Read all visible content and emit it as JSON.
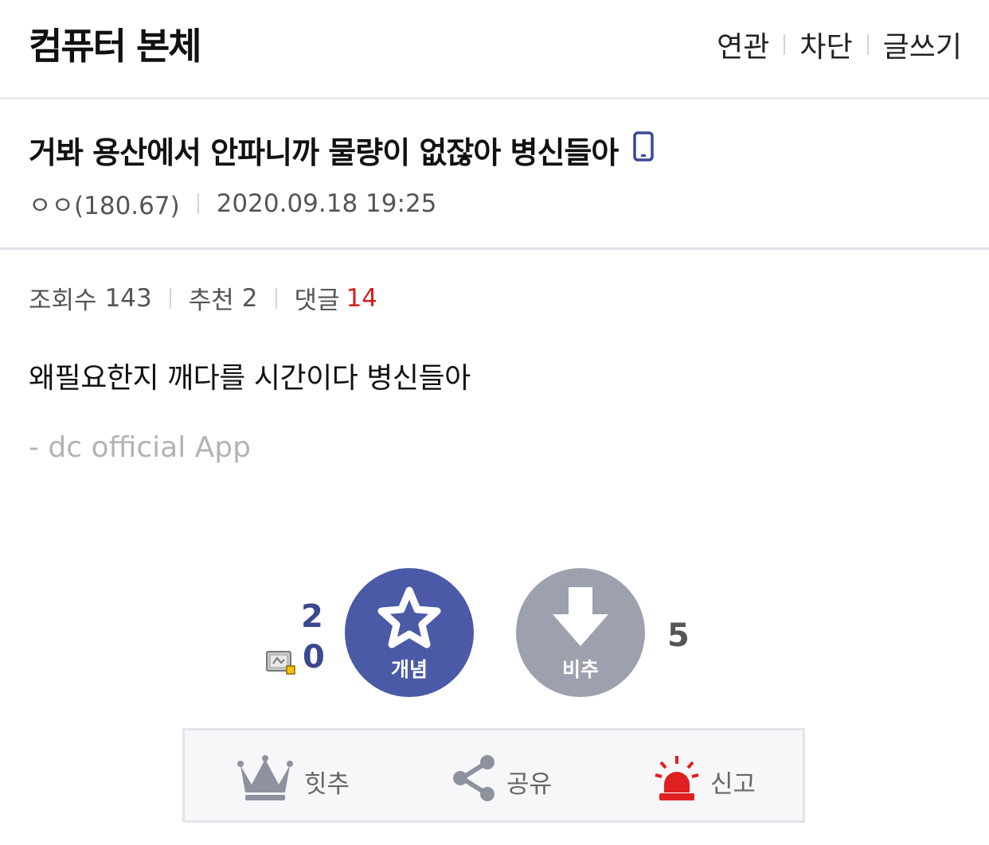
{
  "header": {
    "gallery_title": "컴퓨터 본체",
    "menu": [
      "연관",
      "차단",
      "글쓰기"
    ]
  },
  "post": {
    "title": "거봐 용산에서 안파니까 물량이 없잖아 병신들아",
    "author": "ㅇㅇ(180.67)",
    "datetime": "2020.09.18 19:25",
    "stats": {
      "views_label": "조회수",
      "views": "143",
      "recommend_label": "추천",
      "recommend": "2",
      "comments_label": "댓글",
      "comments": "14"
    },
    "body": "왜필요한지 깨다를 시간이다 병신들아",
    "signature": "- dc official App"
  },
  "vote": {
    "up_count": "2",
    "fixed_count": "0",
    "up_label": "개념",
    "down_label": "비추",
    "down_count": "5"
  },
  "actions": [
    "힛추",
    "공유",
    "신고"
  ],
  "colors": {
    "accent": "#4b5aa6",
    "down_button": "#9da1ad",
    "comment_count": "#d31f1f",
    "report_icon": "#e02020"
  }
}
